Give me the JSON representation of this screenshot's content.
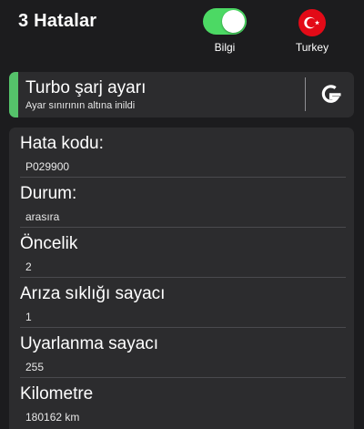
{
  "header": {
    "title": "3 Hatalar",
    "toggle_label": "Bilgi",
    "toggle_on": true,
    "flag_label": "Turkey"
  },
  "banner": {
    "title": "Turbo şarj ayarı",
    "subtitle": "Ayar sınırının altına inildi",
    "accent_color": "#55c26a",
    "icon": "google-g-icon"
  },
  "details": [
    {
      "label": "Hata kodu:",
      "value": "P029900"
    },
    {
      "label": "Durum:",
      "value": "arasıra"
    },
    {
      "label": "Öncelik",
      "value": "2"
    },
    {
      "label": "Arıza sıklığı sayacı",
      "value": "1"
    },
    {
      "label": "Uyarlanma sayacı",
      "value": "255"
    },
    {
      "label": "Kilometre",
      "value": "180162 km"
    }
  ],
  "colors": {
    "background": "#1c1c1e",
    "card": "#2c2c2e",
    "toggle_on": "#4cd964",
    "flag_red": "#e30a17"
  }
}
